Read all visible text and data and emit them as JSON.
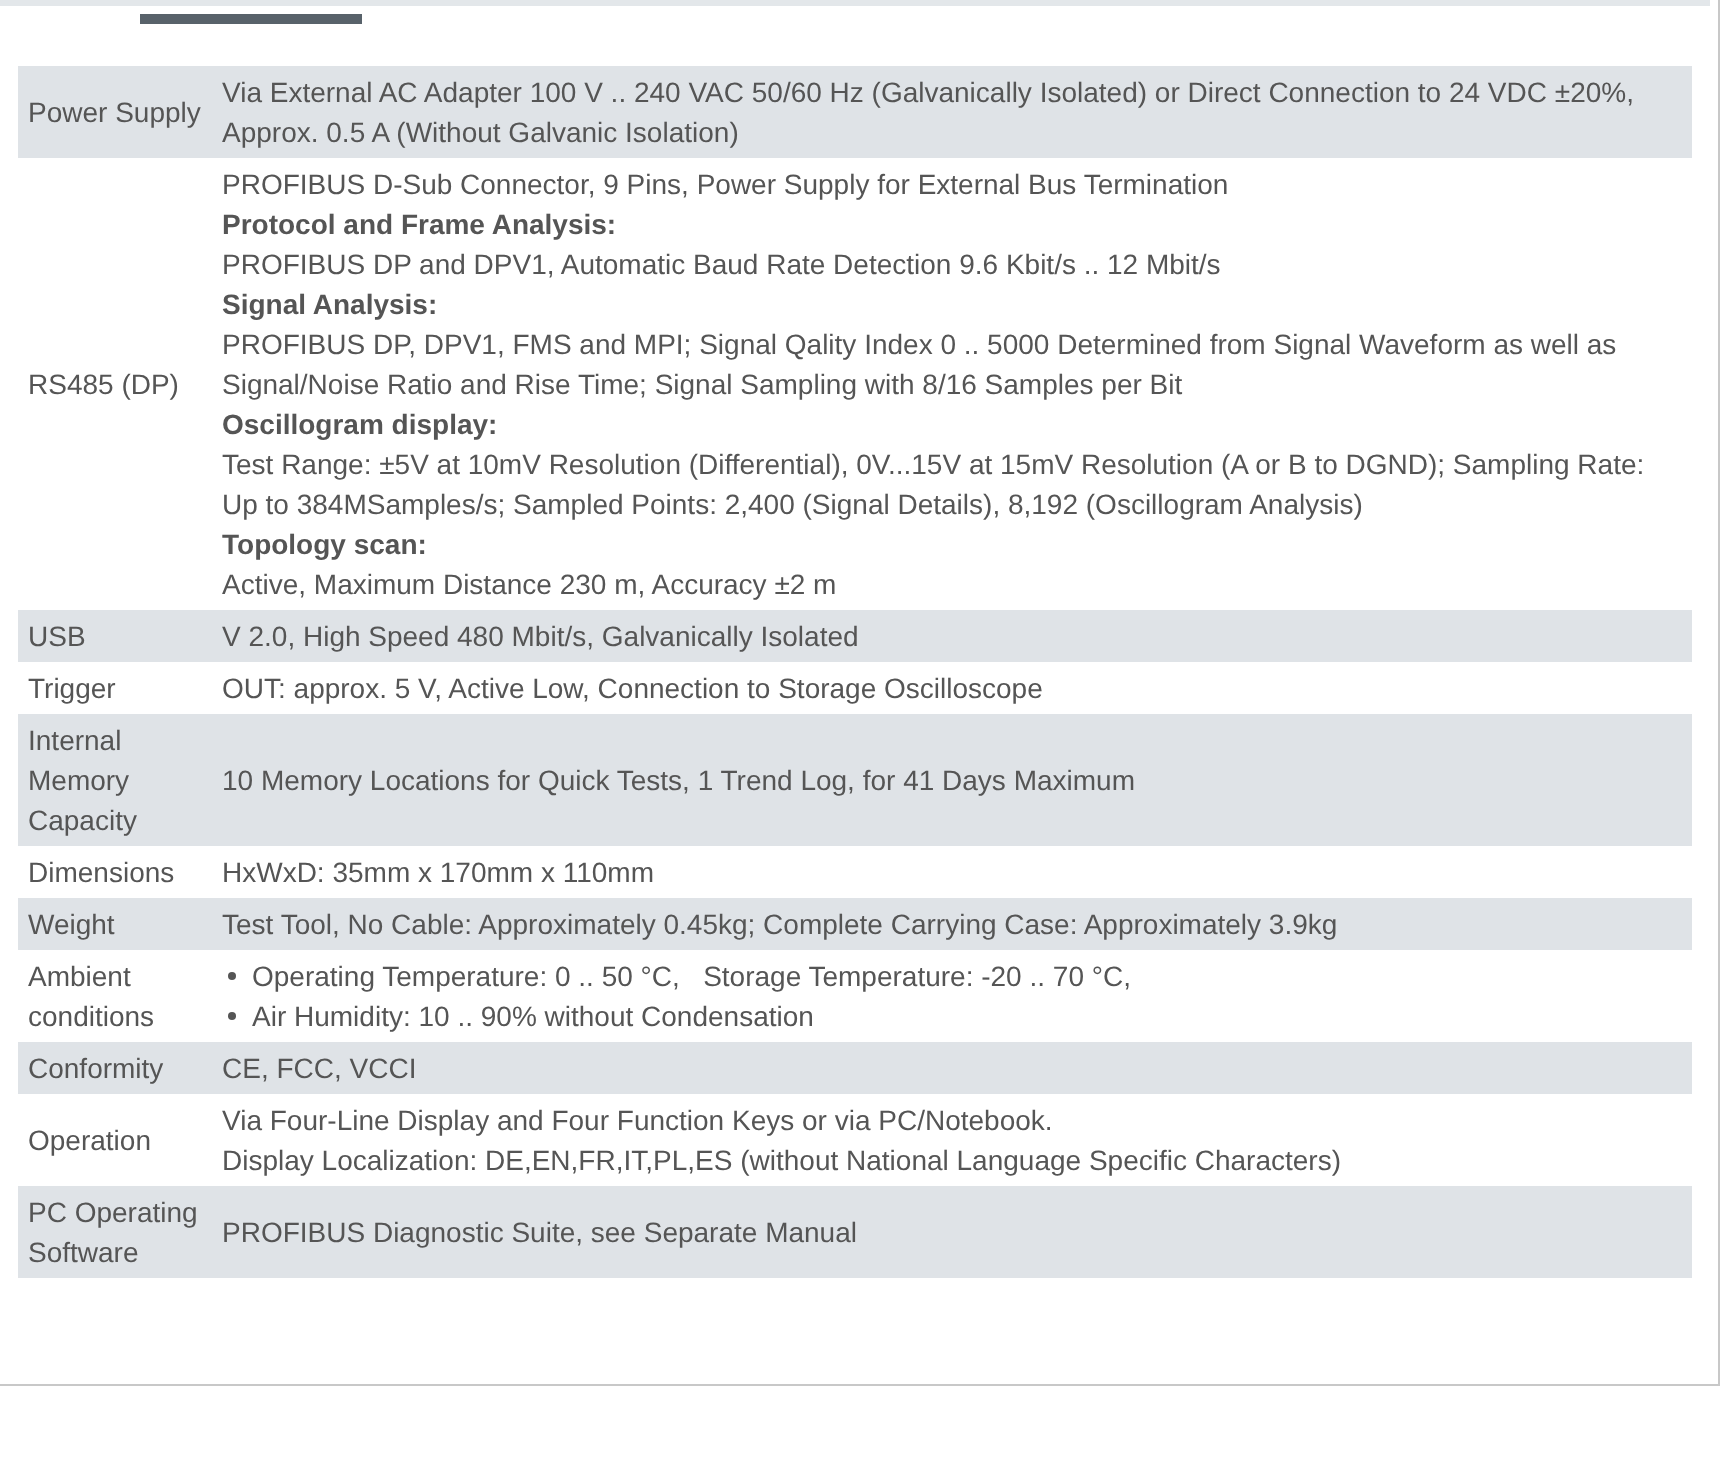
{
  "specs": [
    {
      "label": "Power Supply",
      "lines": [
        {
          "kind": "text",
          "text": "Via External AC Adapter 100 V .. 240 VAC 50/60 Hz (Galvanically Isolated) or Direct Connection to 24 VDC ±20%, Approx. 0.5 A (Without Galvanic Isolation)"
        }
      ]
    },
    {
      "label": "RS485 (DP)",
      "lines": [
        {
          "kind": "text",
          "text": "PROFIBUS D-Sub Connector, 9 Pins, Power Supply for External Bus Termination"
        },
        {
          "kind": "heading",
          "text": "Protocol and Frame Analysis:"
        },
        {
          "kind": "text",
          "text": "PROFIBUS DP and DPV1, Automatic Baud Rate Detection 9.6 Kbit/s .. 12 Mbit/s"
        },
        {
          "kind": "heading",
          "text": "Signal Analysis:"
        },
        {
          "kind": "text",
          "text": "PROFIBUS DP, DPV1, FMS and MPI; Signal Qality Index 0 .. 5000 Determined from Signal Waveform as well as Signal/Noise Ratio and Rise Time; Signal Sampling with 8/16 Samples per Bit"
        },
        {
          "kind": "heading",
          "text": "Oscillogram display:"
        },
        {
          "kind": "text",
          "text": "Test Range: ±5V at 10mV Resolution (Differential), 0V...15V at 15mV Resolution (A or B to DGND); Sampling Rate: Up to 384MSamples/s; Sampled Points: 2,400 (Signal Details), 8,192 (Oscillogram Analysis)"
        },
        {
          "kind": "heading",
          "text": "Topology scan:"
        },
        {
          "kind": "text",
          "text": "Active, Maximum Distance 230 m, Accuracy ±2 m"
        }
      ]
    },
    {
      "label": "USB",
      "lines": [
        {
          "kind": "text",
          "text": "V 2.0, High Speed 480 Mbit/s, Galvanically Isolated"
        }
      ]
    },
    {
      "label": "Trigger",
      "lines": [
        {
          "kind": "text",
          "text": "OUT: approx. 5 V, Active Low, Connection to Storage Oscilloscope"
        }
      ]
    },
    {
      "label": "Internal Memory Capacity",
      "lines": [
        {
          "kind": "text",
          "text": "10 Memory Locations for Quick Tests, 1 Trend Log, for 41 Days Maximum"
        }
      ]
    },
    {
      "label": "Dimensions",
      "lines": [
        {
          "kind": "text",
          "text": "HxWxD: 35mm x 170mm x 110mm"
        }
      ]
    },
    {
      "label": "Weight",
      "lines": [
        {
          "kind": "text",
          "text": "Test Tool, No Cable: Approximately 0.45kg; Complete Carrying Case: Approximately 3.9kg"
        }
      ]
    },
    {
      "label": "Ambient conditions",
      "lines": [
        {
          "kind": "bullet",
          "text": "Operating Temperature: 0 .. 50 °C,   Storage Temperature: -20 .. 70 °C,"
        },
        {
          "kind": "bullet",
          "text": "Air Humidity: 10 .. 90% without Condensation"
        }
      ]
    },
    {
      "label": "Conformity",
      "lines": [
        {
          "kind": "text",
          "text": "CE, FCC, VCCI"
        }
      ]
    },
    {
      "label": "Operation",
      "lines": [
        {
          "kind": "text",
          "text": "Via Four-Line Display and Four Function Keys or via PC/Notebook."
        },
        {
          "kind": "text",
          "text": "Display Localization: DE,EN,FR,IT,PL,ES (without National Language Specific Characters)"
        }
      ]
    },
    {
      "label": "PC Operating Software",
      "lines": [
        {
          "kind": "text",
          "text": "PROFIBUS Diagnostic Suite, see Separate Manual"
        }
      ]
    }
  ]
}
